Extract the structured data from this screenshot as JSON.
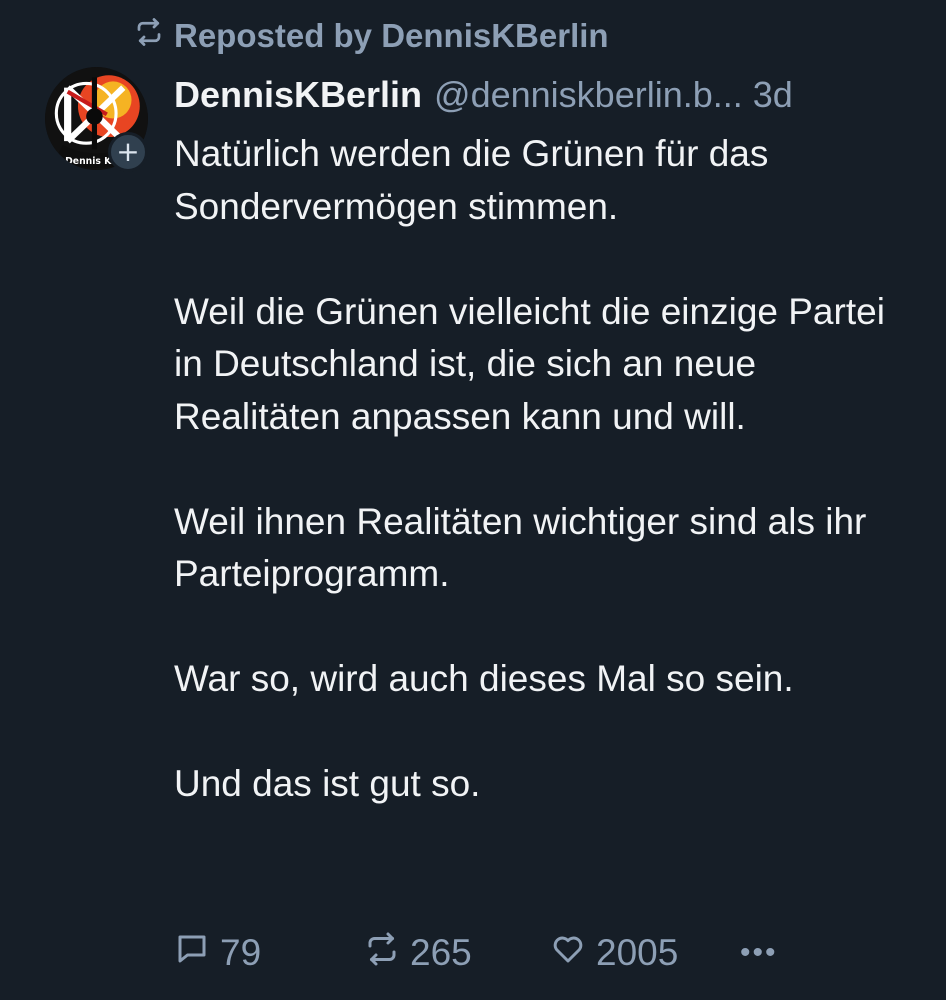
{
  "repost": {
    "icon": "repost-icon",
    "label": "Reposted by DennisKBerlin"
  },
  "author": {
    "avatar_text": "Dennis K Be",
    "display_name": "DennisKBerlin",
    "handle": "@denniskberlin.b...",
    "time": "3d",
    "follow_icon": "plus-icon",
    "follow_label": "+"
  },
  "post": {
    "paragraphs": [
      "Natürlich werden die Grünen für das Sondervermögen stimmen.",
      "Weil die Grünen vielleicht die einzige Partei in Deutschland ist, die sich an neue Realitäten anpassen kann und will.",
      "Weil ihnen Realitäten wichtiger sind als ihr Parteiprogramm.",
      "War so, wird auch dieses Mal so sein.",
      "Und das ist gut so."
    ]
  },
  "actions": {
    "reply_count": "79",
    "repost_count": "265",
    "like_count": "2005",
    "more_label": "•••"
  },
  "colors": {
    "background": "#161e27",
    "text": "#f1f3f5",
    "muted": "#8d9fb5"
  }
}
